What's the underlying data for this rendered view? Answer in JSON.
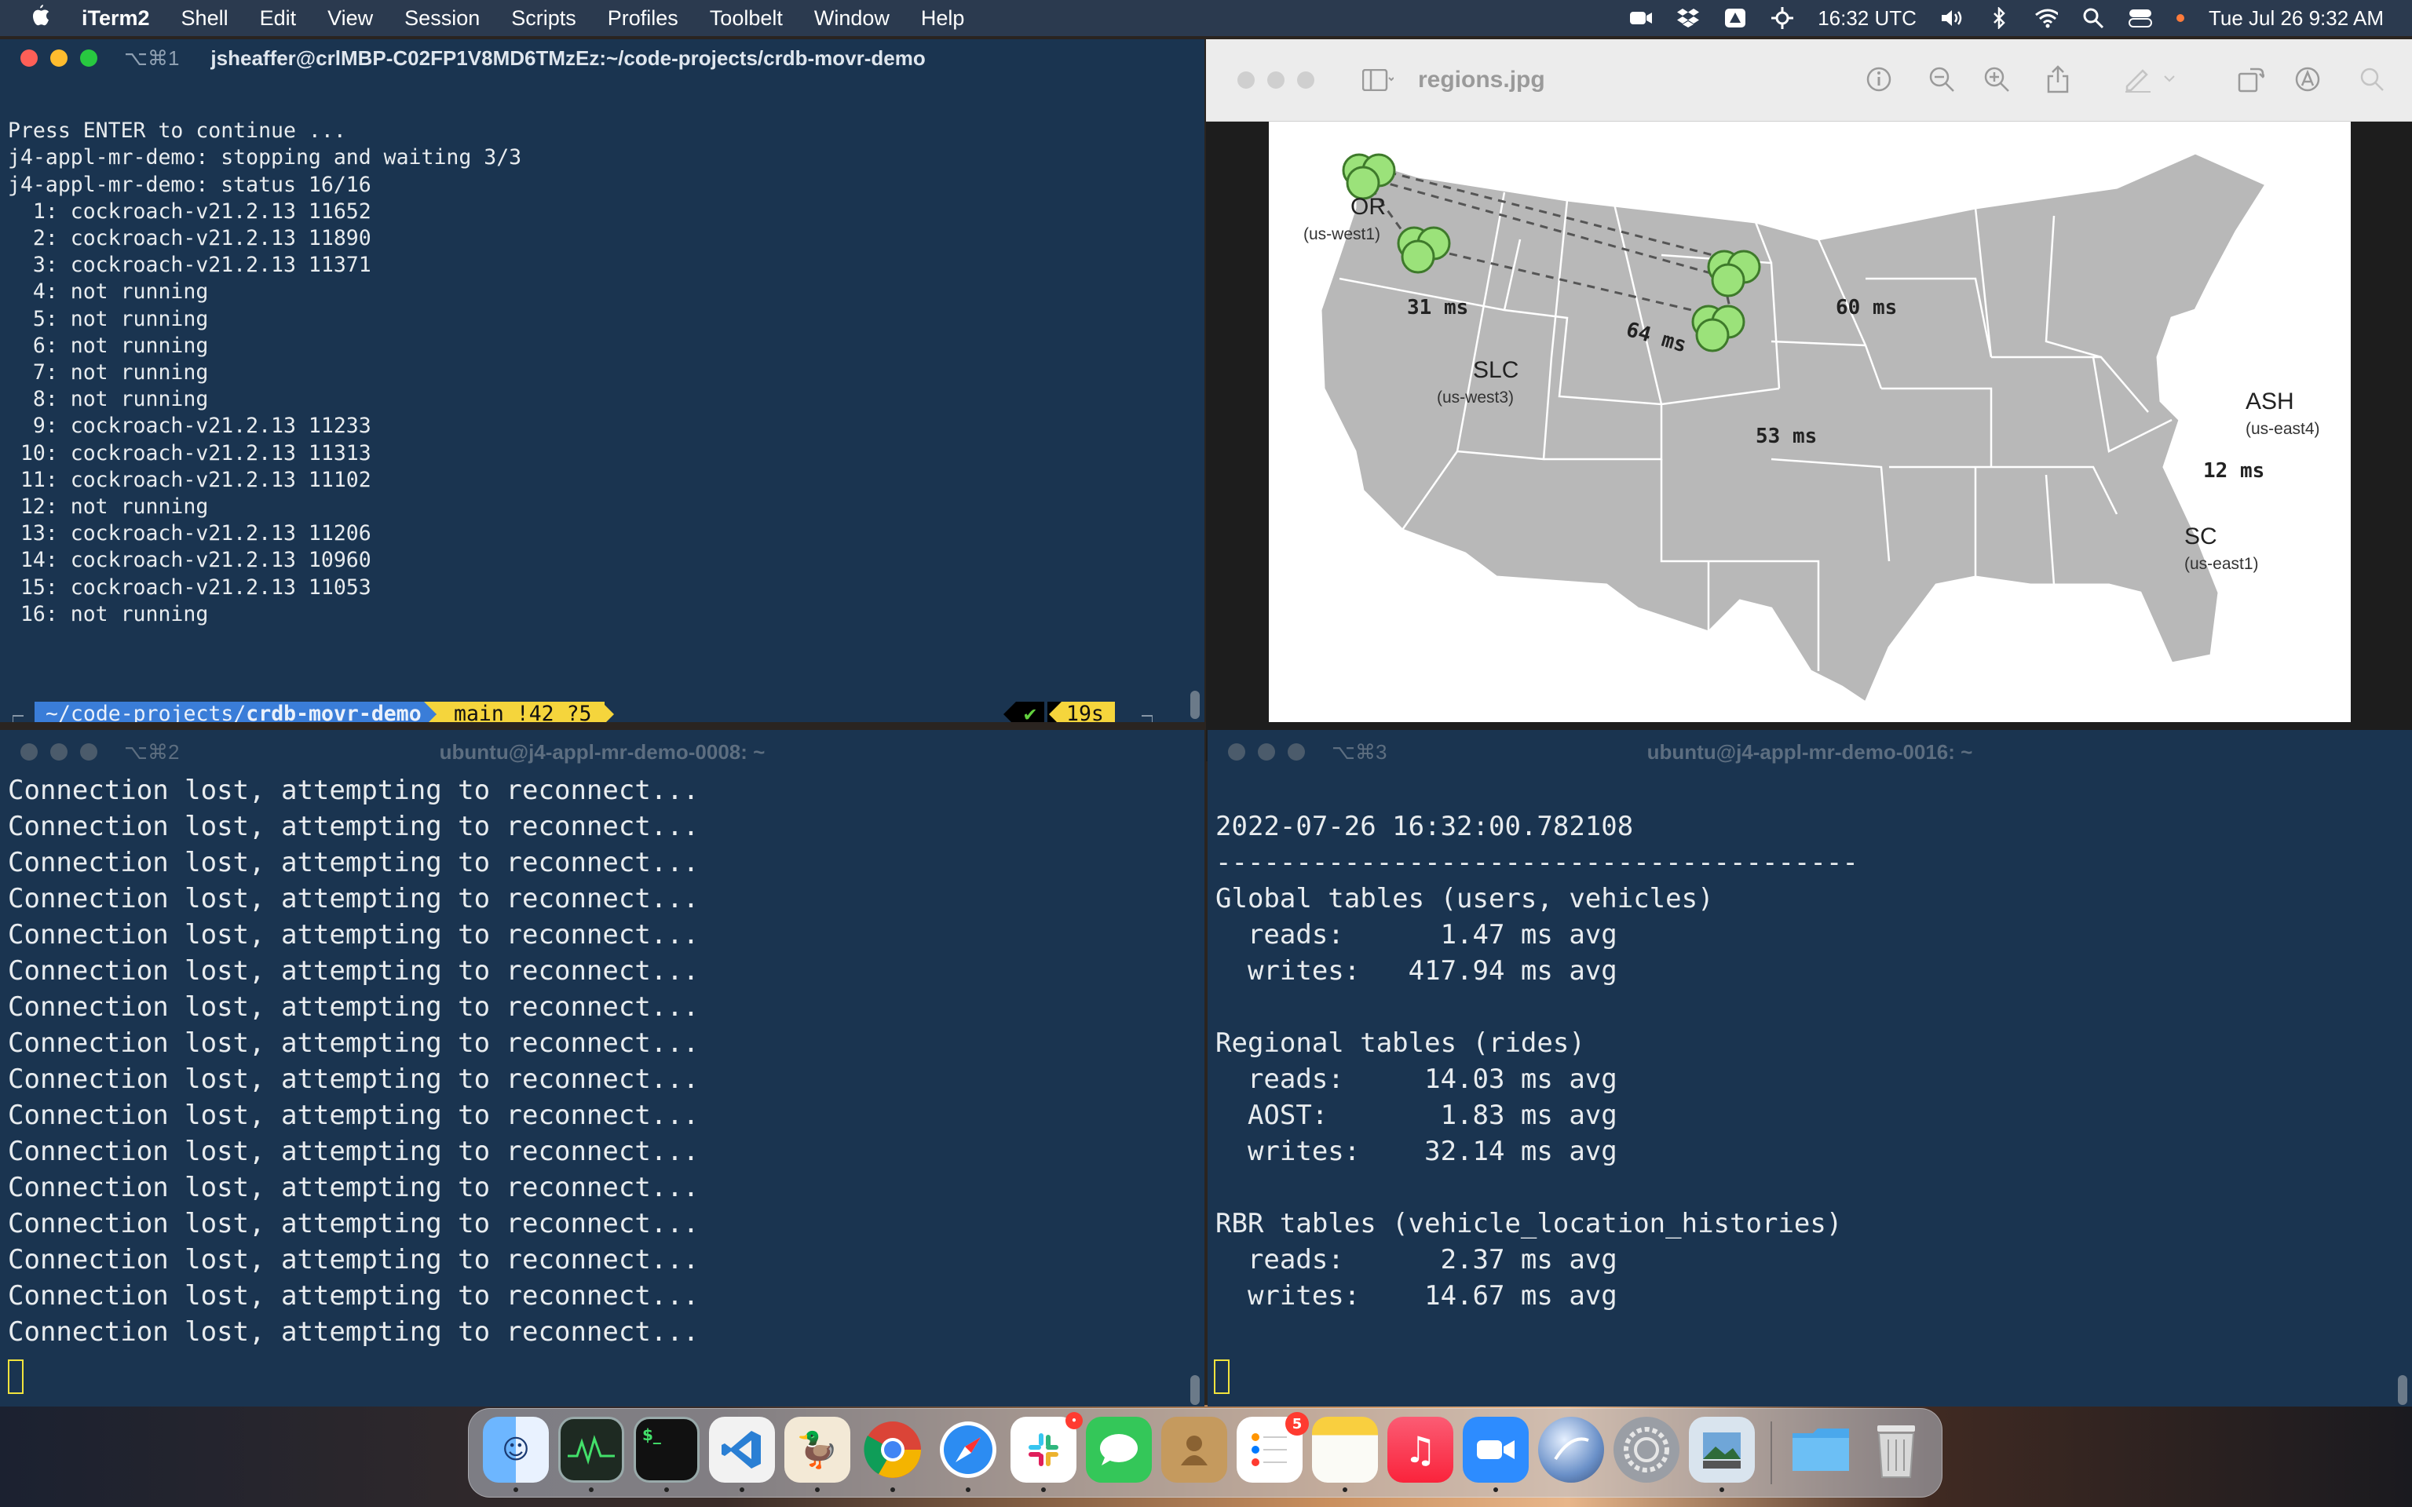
{
  "menubar": {
    "app": "iTerm2",
    "items": [
      "Shell",
      "Edit",
      "View",
      "Session",
      "Scripts",
      "Profiles",
      "Toolbelt",
      "Window",
      "Help"
    ],
    "time_utc": "16:32 UTC",
    "clock": "Tue Jul 26  9:32 AM"
  },
  "term1": {
    "shortcut": "⌥⌘1",
    "title": "jsheaffer@crlMBP-C02FP1V8MD6TMzEz:~/code-projects/crdb-movr-demo",
    "lines": [
      "",
      "Press ENTER to continue ...",
      "j4-appl-mr-demo: stopping and waiting 3/3",
      "j4-appl-mr-demo: status 16/16",
      "  1: cockroach-v21.2.13 11652",
      "  2: cockroach-v21.2.13 11890",
      "  3: cockroach-v21.2.13 11371",
      "  4: not running",
      "  5: not running",
      "  6: not running",
      "  7: not running",
      "  8: not running",
      "  9: cockroach-v21.2.13 11233",
      " 10: cockroach-v21.2.13 11313",
      " 11: cockroach-v21.2.13 11102",
      " 12: not running",
      " 13: cockroach-v21.2.13 11206",
      " 14: cockroach-v21.2.13 10960",
      " 15: cockroach-v21.2.13 11053",
      " 16: not running"
    ],
    "prompt_dir_prefix": "~/code-projects/",
    "prompt_dir_bold": "crdb-movr-demo",
    "prompt_git": "main !42 ?5",
    "prompt_status": "✔",
    "prompt_duration": "19s"
  },
  "term2": {
    "shortcut": "⌥⌘2",
    "title": "ubuntu@j4-appl-mr-demo-0008: ~",
    "line": "Connection lost, attempting to reconnect...",
    "line_count": 16
  },
  "term3": {
    "shortcut": "⌥⌘3",
    "title": "ubuntu@j4-appl-mr-demo-0016: ~",
    "lines": [
      "",
      "2022-07-26 16:32:00.782108",
      "----------------------------------------",
      "Global tables (users, vehicles)",
      "  reads:      1.47 ms avg",
      "  writes:   417.94 ms avg",
      "",
      "Regional tables (rides)",
      "  reads:     14.03 ms avg",
      "  AOST:       1.83 ms avg",
      "  writes:    32.14 ms avg",
      "",
      "RBR tables (vehicle_location_histories)",
      "  reads:      2.37 ms avg",
      "  writes:    14.67 ms avg"
    ]
  },
  "preview": {
    "title": "regions.jpg",
    "regions": [
      {
        "name": "OR",
        "code": "(us-west1)"
      },
      {
        "name": "SLC",
        "code": "(us-west3)"
      },
      {
        "name": "ASH",
        "code": "(us-east4)"
      },
      {
        "name": "SC",
        "code": "(us-east1)"
      }
    ],
    "latencies": [
      "31 ms",
      "64 ms",
      "60 ms",
      "53 ms",
      "12 ms"
    ]
  },
  "dock": {
    "apps": [
      "finder",
      "activity-monitor",
      "terminal",
      "vscode",
      "cyberduck",
      "chrome",
      "safari",
      "slack",
      "messages",
      "contacts",
      "reminders",
      "notes",
      "music",
      "zoom",
      "network-utility",
      "system-preferences",
      "preview",
      "downloads-folder",
      "trash"
    ],
    "reminders_badge": "5"
  }
}
